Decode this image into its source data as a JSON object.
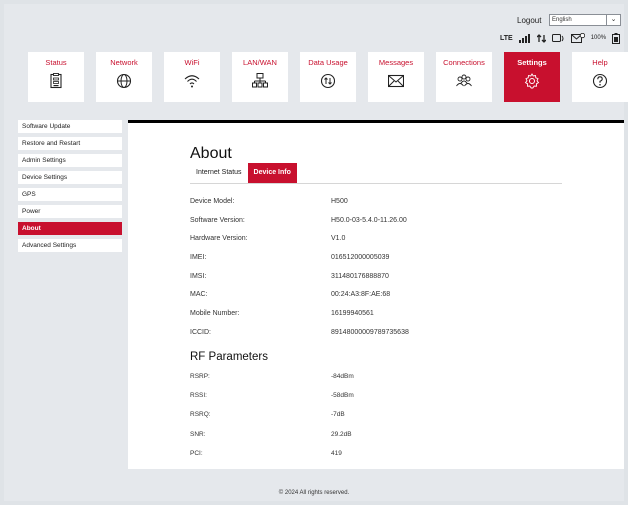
{
  "header": {
    "logout_label": "Logout",
    "language_selected": "English",
    "network_type": "LTE",
    "battery_text": "100%"
  },
  "nav": {
    "tiles": [
      {
        "label": "Status",
        "icon": "status-icon"
      },
      {
        "label": "Network",
        "icon": "globe-icon"
      },
      {
        "label": "WiFi",
        "icon": "wifi-icon"
      },
      {
        "label": "LAN/WAN",
        "icon": "lan-icon"
      },
      {
        "label": "Data Usage",
        "icon": "data-usage-icon"
      },
      {
        "label": "Messages",
        "icon": "envelope-icon"
      },
      {
        "label": "Connections",
        "icon": "users-icon"
      },
      {
        "label": "Settings",
        "icon": "gear-icon"
      },
      {
        "label": "Help",
        "icon": "help-icon"
      }
    ],
    "active": "Settings"
  },
  "sidebar": {
    "items": [
      {
        "label": "Software Update"
      },
      {
        "label": "Restore and Restart"
      },
      {
        "label": "Admin Settings"
      },
      {
        "label": "Device Settings"
      },
      {
        "label": "GPS"
      },
      {
        "label": "Power"
      },
      {
        "label": "About"
      },
      {
        "label": "Advanced Settings"
      }
    ],
    "active": "About"
  },
  "main": {
    "title": "About",
    "tabs": [
      {
        "label": "Internet Status"
      },
      {
        "label": "Device Info"
      }
    ],
    "active_tab": "Device Info",
    "device_info": [
      {
        "key": "Device Model:",
        "value": "H500"
      },
      {
        "key": "Software Version:",
        "value": "H50.0-03-5.4.0-11.26.00"
      },
      {
        "key": "Hardware Version:",
        "value": "V1.0"
      },
      {
        "key": "IMEI:",
        "value": "016512000005039"
      },
      {
        "key": "IMSI:",
        "value": "311480176888870"
      },
      {
        "key": "MAC:",
        "value": "00:24:A3:8F:AE:68"
      },
      {
        "key": "Mobile Number:",
        "value": "16199940561"
      },
      {
        "key": "ICCID:",
        "value": "89148000009789735638"
      }
    ],
    "rf_title": "RF Parameters",
    "rf_params": [
      {
        "key": "RSRP:",
        "value": "-84dBm"
      },
      {
        "key": "RSSI:",
        "value": "-58dBm"
      },
      {
        "key": "RSRQ:",
        "value": "-7dB"
      },
      {
        "key": "SNR:",
        "value": "29.2dB"
      },
      {
        "key": "PCI:",
        "value": "419"
      }
    ]
  },
  "footer": {
    "text": "© 2024 All rights reserved."
  },
  "colors": {
    "accent": "#c8102e",
    "background": "#dfe3e7",
    "panel": "#ffffff"
  }
}
